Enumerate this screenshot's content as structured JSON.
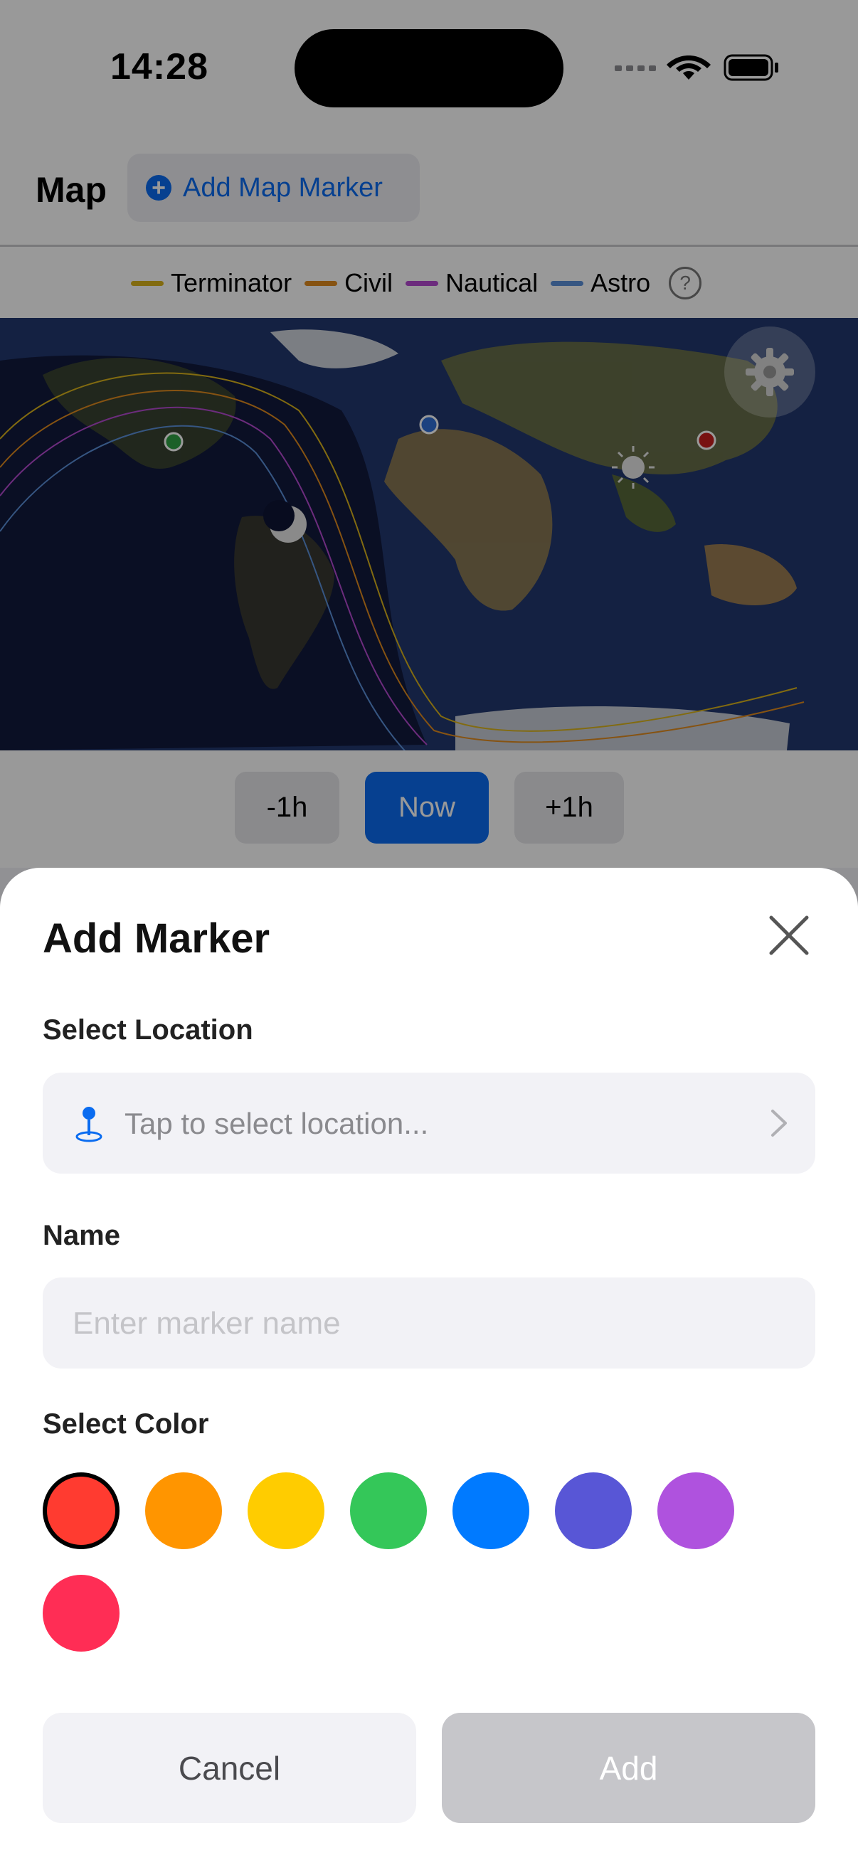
{
  "status": {
    "time": "14:28"
  },
  "header": {
    "title": "Map",
    "add_marker_label": "Add Map Marker"
  },
  "legend": {
    "items": [
      {
        "label": "Terminator",
        "color": "#d9b21c"
      },
      {
        "label": "Civil",
        "color": "#e08a1e"
      },
      {
        "label": "Nautical",
        "color": "#b44ad0"
      },
      {
        "label": "Astro",
        "color": "#5b8fd9"
      }
    ],
    "help": "?"
  },
  "time_controls": {
    "minus": "-1h",
    "now": "Now",
    "plus": "+1h"
  },
  "sheet": {
    "title": "Add Marker",
    "location_label": "Select Location",
    "location_placeholder": "Tap to select location...",
    "name_label": "Name",
    "name_placeholder": "Enter marker name",
    "color_label": "Select Color",
    "colors": [
      "#ff3b30",
      "#ff9500",
      "#ffcc00",
      "#34c759",
      "#007aff",
      "#5856d6",
      "#af52de",
      "#ff2d55"
    ],
    "selected_color": "#ff3b30",
    "cancel_label": "Cancel",
    "add_label": "Add"
  }
}
